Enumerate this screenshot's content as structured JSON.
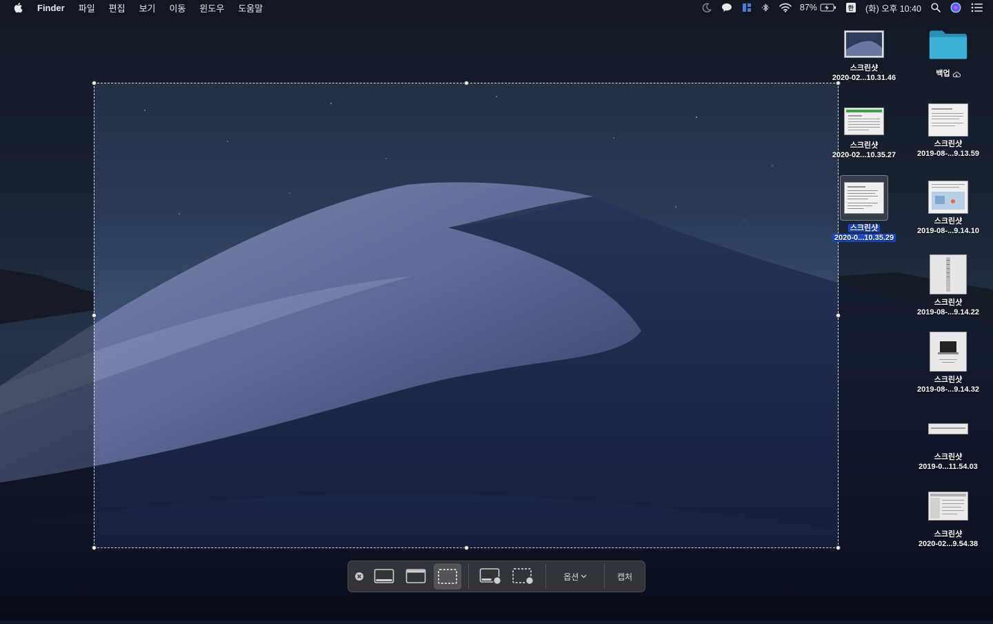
{
  "menubar": {
    "app_name": "Finder",
    "menus": [
      "파일",
      "편집",
      "보기",
      "이동",
      "윈도우",
      "도움말"
    ],
    "status": {
      "battery_percent": "87%",
      "input_method": "한",
      "datetime": "(화) 오후 10:40"
    }
  },
  "desktop_icons": [
    {
      "line1": "스크린샷",
      "line2": "2020-02...10.31.46",
      "kind": "landscape"
    },
    {
      "line1": "백업",
      "line2": "",
      "kind": "folder",
      "cloud": true
    },
    {
      "line1": "스크린샷",
      "line2": "2020-02...10.35.27",
      "kind": "sheet"
    },
    {
      "line1": "스크린샷",
      "line2": "2019-08-...9.13.59",
      "kind": "doc"
    },
    {
      "line1": "스크린샷",
      "line2": "2020-0...10.35.29",
      "kind": "doc",
      "selected": true
    },
    {
      "line1": "스크린샷",
      "line2": "2019-08-...9.14.10",
      "kind": "map"
    },
    {
      "line1": "스크린샷",
      "line2": "2019-08-...9.14.22",
      "kind": "tall"
    },
    {
      "line1": "스크린샷",
      "line2": "2019-08-...9.14.32",
      "kind": "laptop"
    },
    {
      "line1": "스크린샷",
      "line2": "2019-0...11.54.03",
      "kind": "strip"
    },
    {
      "line1": "스크린샷",
      "line2": "2020-02...9.54.38",
      "kind": "window"
    }
  ],
  "toolbar": {
    "options_label": "옵션",
    "capture_label": "캡처",
    "active_tool": "capture-selection"
  }
}
